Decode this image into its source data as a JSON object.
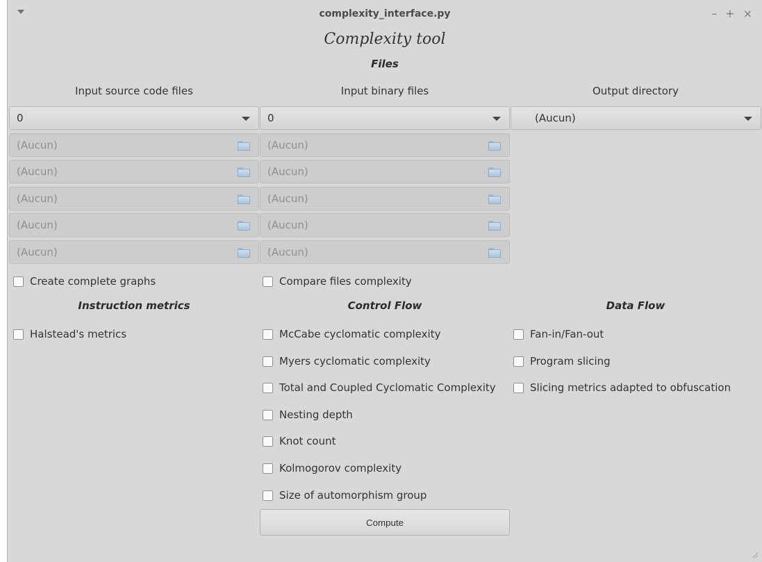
{
  "window": {
    "title": "complexity_interface.py",
    "controls": {
      "minimize": "–",
      "maximize": "+",
      "close": "×"
    }
  },
  "app_title": "Complexity tool",
  "files": {
    "section_label": "Files",
    "source": {
      "header": "Input source code files",
      "count_value": "0",
      "slots": [
        "(Aucun)",
        "(Aucun)",
        "(Aucun)",
        "(Aucun)",
        "(Aucun)"
      ]
    },
    "binary": {
      "header": "Input binary files",
      "count_value": "0",
      "slots": [
        "(Aucun)",
        "(Aucun)",
        "(Aucun)",
        "(Aucun)",
        "(Aucun)"
      ]
    },
    "output": {
      "header": "Output directory",
      "value": "(Aucun)"
    }
  },
  "options": {
    "complete_graphs": "Create complete graphs",
    "compare_files": "Compare files complexity"
  },
  "instruction_metrics": {
    "header": "Instruction metrics",
    "items": [
      "Halstead's metrics"
    ]
  },
  "control_flow": {
    "header": "Control Flow",
    "items": [
      "McCabe cyclomatic complexity",
      "Myers cyclomatic complexity",
      "Total and Coupled Cyclomatic Complexity",
      "Nesting depth",
      "Knot count",
      "Kolmogorov complexity",
      "Size of automorphism group"
    ]
  },
  "data_flow": {
    "header": "Data Flow",
    "items": [
      "Fan-in/Fan-out",
      "Program slicing",
      "Slicing metrics adapted to obfuscation"
    ]
  },
  "compute_label": "Compute"
}
